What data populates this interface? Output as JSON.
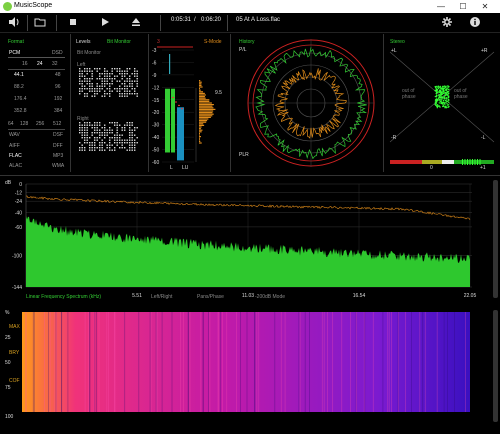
{
  "window": {
    "title": "MusicScope",
    "minimize": "—",
    "maximize": "☐",
    "close": "✕"
  },
  "toolbar": {
    "time_elapsed": "0:05:31",
    "time_sep": "/",
    "time_total": "0:06:20",
    "track": "05 At A Loss.flac"
  },
  "format": {
    "title": "Format",
    "pcm": "PCM",
    "dsd": "DSD",
    "bit_row": [
      "16",
      "24",
      "32"
    ],
    "bit_active": "24",
    "rates_left": [
      "44.1",
      "88.2",
      "176.4",
      "352.8"
    ],
    "rates_right": [
      "48",
      "96",
      "192",
      "384"
    ],
    "rates_active": "44.1",
    "bottom": [
      "64",
      "128",
      "256",
      "512"
    ],
    "containers": [
      [
        "WAV",
        "DSF"
      ],
      [
        "AIFF",
        "DFF"
      ],
      [
        "FLAC",
        "MP3"
      ],
      [
        "ALAC",
        "WMA"
      ]
    ],
    "container_active": "FLAC"
  },
  "levels": {
    "title": "Levels",
    "bitmonitor_tab": "Bit Monitor",
    "bitmonitor_label": "Bit Monitor",
    "left": "Left",
    "right": "Right"
  },
  "meter": {
    "title": "S-Mode",
    "mark_3": "3",
    "scale": [
      "-3",
      "-6",
      "-9",
      "-12",
      "-15",
      "-20",
      "-30",
      "-40",
      "-50",
      "-60"
    ],
    "peak_label": "9.5",
    "l": "L",
    "r": "LU",
    "levels": {
      "left_fraction": 0.63,
      "right_fraction": 0.55
    }
  },
  "history": {
    "title": "History",
    "pl": "P/L",
    "plr": "PLR"
  },
  "stereo": {
    "title": "Stereo",
    "top_left": "+L",
    "top_right": "+R",
    "mid_left": "-R",
    "mid_right": "-L",
    "out_phase_left": "out of phase",
    "out_phase_right": "out of phase",
    "corr_mid": "0",
    "corr_right": "+1"
  },
  "spectrum": {
    "ylabel": "dB",
    "yticks": [
      "0",
      "-12",
      "-24",
      "-40",
      "-60",
      "-100",
      "-144"
    ],
    "xticks": [
      "5.51",
      "11.03",
      "16.54",
      "22.05"
    ],
    "tabs": [
      "Linear Frequency Spectrum (kHz)",
      "Left/Right",
      "Pans/Phase",
      "-200dB Mode"
    ]
  },
  "spectrogram": {
    "yticks": [
      "%",
      "25",
      "50",
      "75",
      "100"
    ],
    "side_labels": [
      "MAX",
      "BRY",
      "COF"
    ]
  },
  "colors": {
    "accent": "#33cc33",
    "amber": "#e08c1a",
    "blue": "#1a90c0",
    "red": "#cc2222"
  }
}
